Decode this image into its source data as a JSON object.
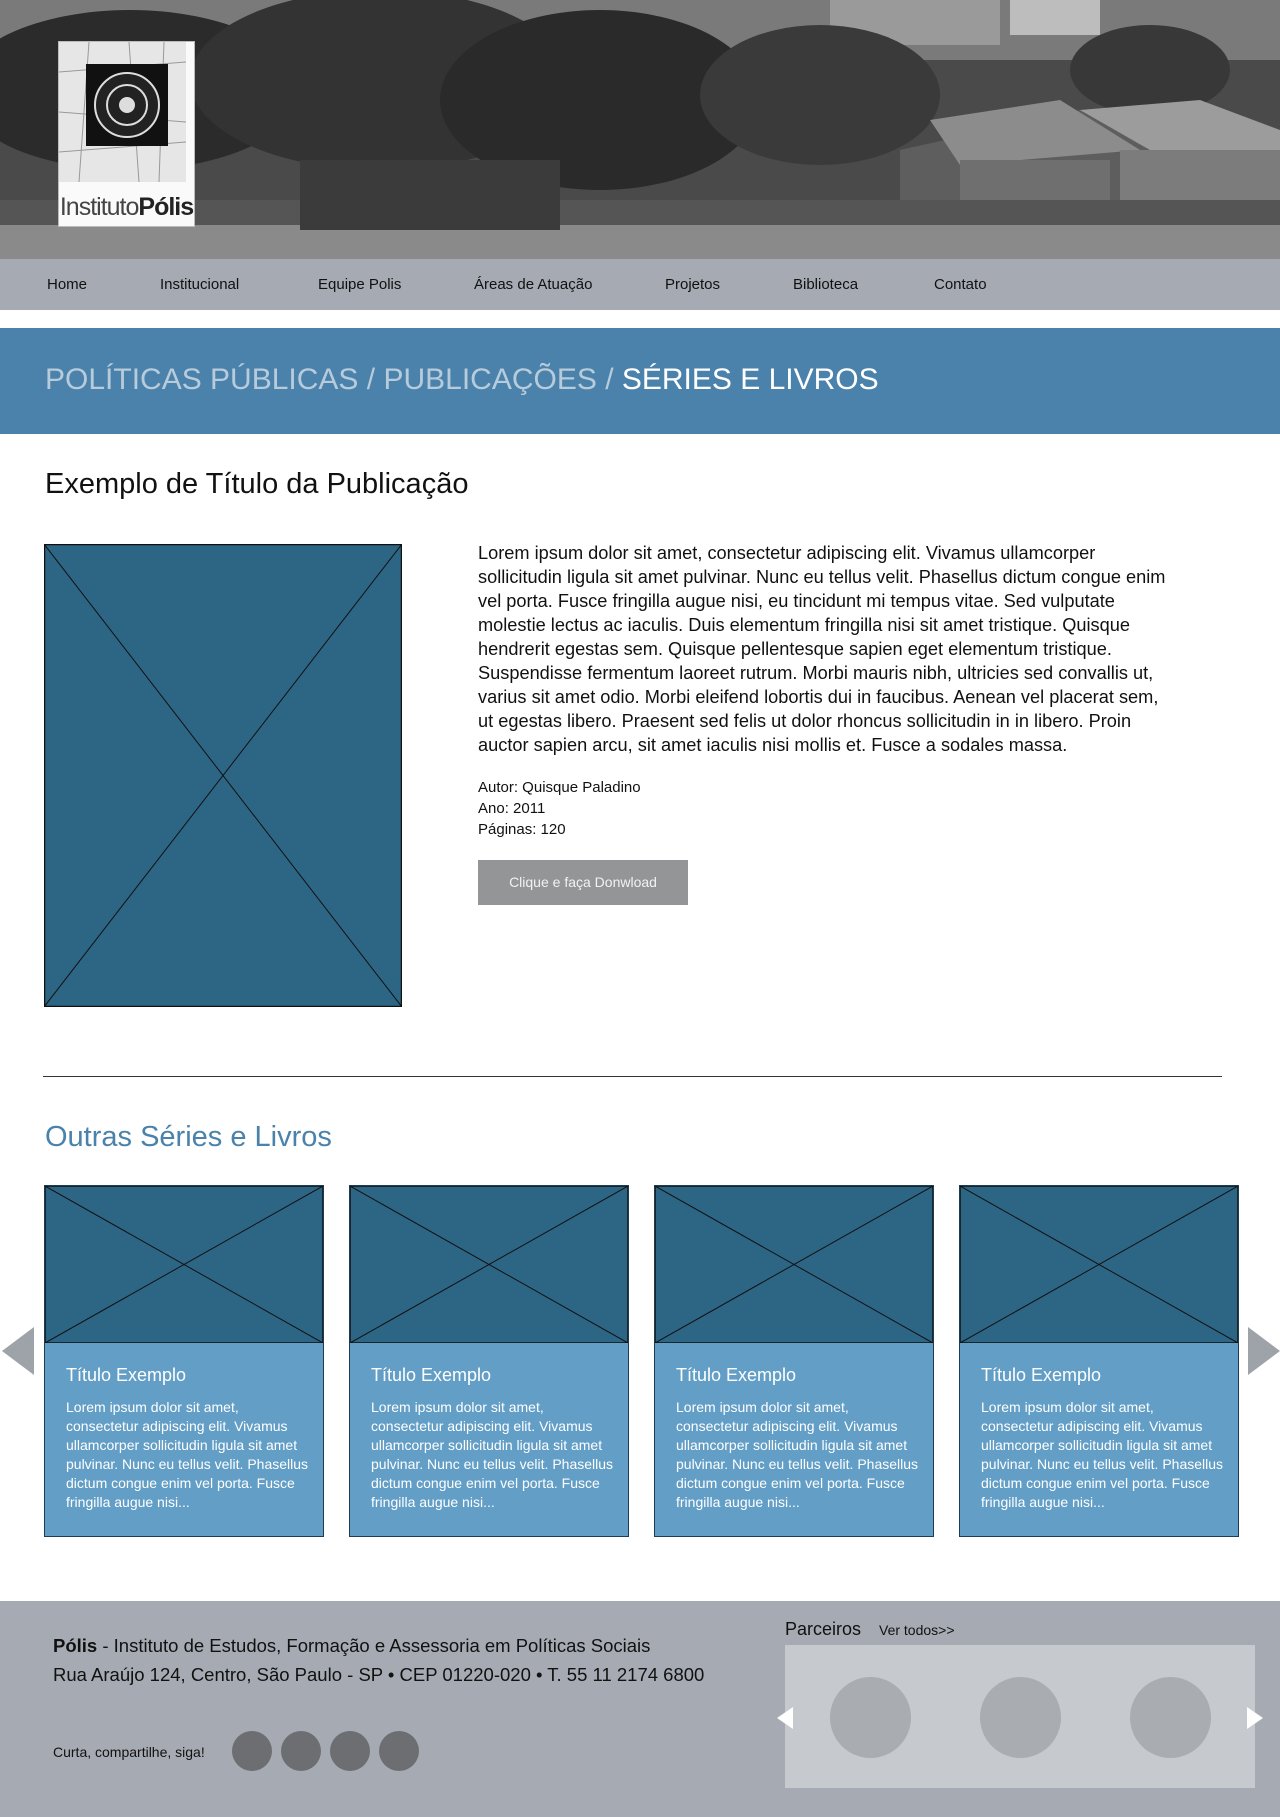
{
  "header": {
    "logo_text_light": "Instituto",
    "logo_text_bold": "Pólis"
  },
  "nav": {
    "items": [
      {
        "label": "Home"
      },
      {
        "label": "Institucional"
      },
      {
        "label": "Equipe Polis"
      },
      {
        "label": "Áreas de Atuação"
      },
      {
        "label": "Projetos"
      },
      {
        "label": "Biblioteca"
      },
      {
        "label": "Contato"
      }
    ]
  },
  "breadcrumb": {
    "items": [
      "POLÍTICAS PÚBLICAS",
      "PUBLICAÇÕES",
      "SÉRIES E LIVROS"
    ],
    "separator": " / "
  },
  "colors": {
    "accent": "#4a82ab",
    "card_bg": "#629ec6",
    "image_placeholder": "#2d6685",
    "nav_bg": "#a6abb3",
    "button_bg": "#939597"
  },
  "publication": {
    "title": "Exemplo de Título da Publicação",
    "description": "Lorem ipsum dolor sit amet, consectetur adipiscing elit. Vivamus ullamcorper sollicitudin ligula sit amet pulvinar. Nunc eu tellus velit. Phasellus dictum congue enim vel porta. Fusce fringilla augue nisi, eu tincidunt mi tempus vitae. Sed vulputate molestie lectus ac iaculis. Duis elementum fringilla nisi sit amet tristique. Quisque hendrerit egestas sem. Quisque pellentesque sapien eget elementum tristique. Suspendisse fermentum laoreet rutrum. Morbi mauris nibh, ultricies sed convallis ut, varius sit amet odio. Morbi eleifend lobortis dui in faucibus. Aenean vel placerat sem, ut egestas libero. Praesent sed felis ut dolor rhoncus sollicitudin in in libero. Proin auctor sapien arcu, sit amet iaculis nisi mollis et. Fusce a sodales massa.",
    "author": "Autor: Quisque Paladino",
    "year": "Ano: 2011",
    "pages": "Páginas: 120",
    "download_label": "Clique e faça Donwload"
  },
  "others": {
    "title": "Outras Séries e Livros",
    "cards": [
      {
        "title": "Título Exemplo",
        "text": "Lorem ipsum dolor sit amet, consectetur adipiscing elit. Vivamus ullamcorper sollicitudin ligula sit amet pulvinar. Nunc eu tellus velit. Phasellus dictum congue enim vel porta. Fusce fringilla augue nisi..."
      },
      {
        "title": "Título Exemplo",
        "text": "Lorem ipsum dolor sit amet, consectetur adipiscing elit. Vivamus ullamcorper sollicitudin ligula sit amet pulvinar. Nunc eu tellus velit. Phasellus dictum congue enim vel porta. Fusce fringilla augue nisi..."
      },
      {
        "title": "Título Exemplo",
        "text": "Lorem ipsum dolor sit amet, consectetur adipiscing elit. Vivamus ullamcorper sollicitudin ligula sit amet pulvinar. Nunc eu tellus velit. Phasellus dictum congue enim vel porta. Fusce fringilla augue nisi..."
      },
      {
        "title": "Título Exemplo",
        "text": "Lorem ipsum dolor sit amet, consectetur adipiscing elit. Vivamus ullamcorper sollicitudin ligula sit amet pulvinar. Nunc eu tellus velit. Phasellus dictum congue enim vel porta. Fusce fringilla augue nisi..."
      }
    ]
  },
  "footer": {
    "org_name": "Pólis",
    "org_desc": " - Instituto de Estudos, Formação e Assessoria em Políticas Sociais",
    "address": "Rua Araújo 124, Centro, São Paulo - SP  •  CEP 01220-020  •  T. 55 11 2174 6800",
    "social_label": "Curta, compartilhe, siga!",
    "partners_title": "Parceiros",
    "partners_link": "Ver todos>>"
  }
}
